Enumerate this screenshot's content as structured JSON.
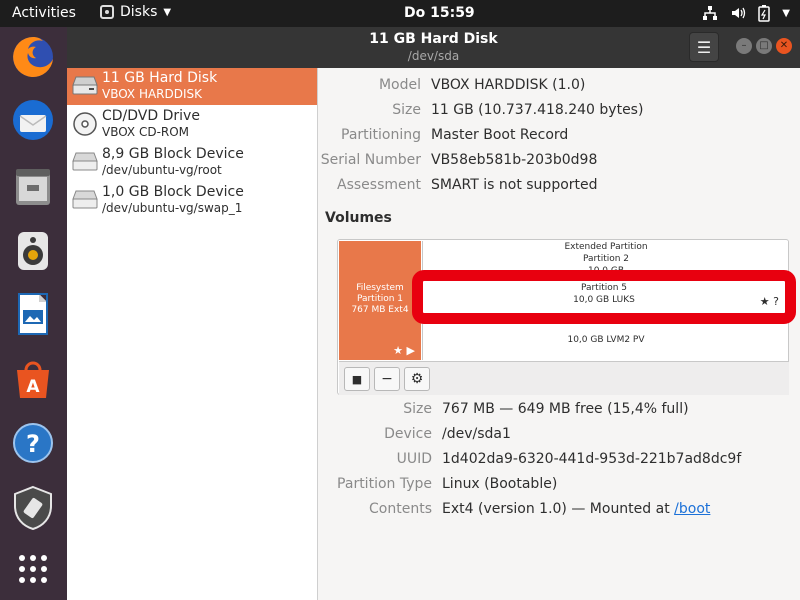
{
  "topbar": {
    "activities": "Activities",
    "app_name": "Disks",
    "clock": "Do 15:59"
  },
  "window": {
    "title": "11 GB Hard Disk",
    "subtitle": "/dev/sda",
    "menu_icon": "☰"
  },
  "dock": {
    "items": [
      "firefox-icon",
      "thunderbird-icon",
      "files-icon",
      "rhythmbox-icon",
      "writer-icon",
      "software-icon",
      "help-icon",
      "usb-creator-icon",
      "show-apps-icon"
    ]
  },
  "devices": [
    {
      "name": "11 GB Hard Disk",
      "sub": "VBOX HARDDISK",
      "selected": true
    },
    {
      "name": "CD/DVD Drive",
      "sub": "VBOX CD-ROM",
      "selected": false
    },
    {
      "name": "8,9 GB Block Device",
      "sub": "/dev/ubuntu-vg/root",
      "selected": false
    },
    {
      "name": "1,0 GB Block Device",
      "sub": "/dev/ubuntu-vg/swap_1",
      "selected": false
    }
  ],
  "disk_info": {
    "model_label": "Model",
    "model": "VBOX HARDDISK (1.0)",
    "size_label": "Size",
    "size": "11 GB (10.737.418.240 bytes)",
    "partitioning_label": "Partitioning",
    "partitioning": "Master Boot Record",
    "serial_label": "Serial Number",
    "serial": "VB58eb581b-203b0d98",
    "assessment_label": "Assessment",
    "assessment": "SMART is not supported"
  },
  "volumes": {
    "title": "Volumes",
    "filesystem": {
      "line1": "Filesystem",
      "line2": "Partition 1",
      "line3": "767 MB Ext4",
      "marks": "★ ▶"
    },
    "extended": {
      "line1": "Extended Partition",
      "line2": "Partition 2",
      "line3": "10,0 GB"
    },
    "partition5": {
      "line1": "Partition 5",
      "line2": "10,0 GB LUKS",
      "mark": "★ ?"
    },
    "lvm": "10,0 GB LVM2 PV",
    "toolbar": {
      "stop": "■",
      "remove": "−",
      "settings": "⚙"
    }
  },
  "partition_info": {
    "size_label": "Size",
    "size": "767 MB — 649 MB free (15,4% full)",
    "device_label": "Device",
    "device": "/dev/sda1",
    "uuid_label": "UUID",
    "uuid": "1d402da9-6320-441d-953d-221b7ad8dc9f",
    "type_label": "Partition Type",
    "type": "Linux (Bootable)",
    "contents_label": "Contents",
    "contents_prefix": "Ext4 (version 1.0) — Mounted at ",
    "contents_link": "/boot"
  }
}
